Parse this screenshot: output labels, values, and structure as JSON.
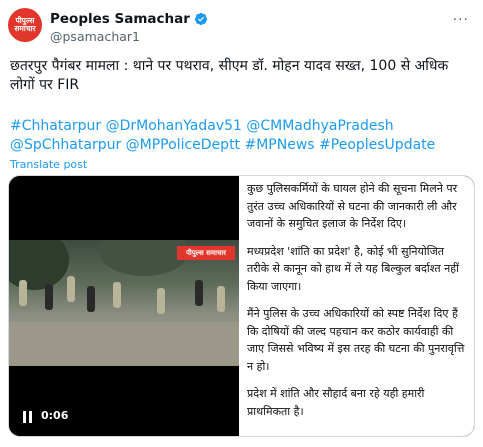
{
  "profile": {
    "avatar_text": "पीपुल्स समाचार",
    "display_name": "Peoples Samachar",
    "handle": "@psamachar1",
    "more_label": "···"
  },
  "tweet": {
    "text": "छतरपुर पैगंबर मामला : थाने पर पथराव, सीएम डॉ. मोहन यादव सख्त, 100 से अधिक लोगों पर FIR",
    "hashtags": "#Chhatarpur @DrMohanYadav51 @CMMadhyaPradesh @SpChhatarpur @MPPoliceDeptt #MPNews #PeoplesUpdate",
    "translate_label": "Translate post"
  },
  "video": {
    "channel_tag": "पीपुल्स समाचार",
    "time": "0:06"
  },
  "panel": {
    "p1": "कुछ पुलिसकर्मियों के घायल होने की सूचना मिलने पर तुरंत उच्च अधिकारियों से घटना की जानकारी ली और जवानों के समुचित इलाज के निर्देश दिए।",
    "p2": "मध्यप्रदेश 'शांति का प्रदेश' है, कोई भी सुनियोजित तरीके से कानून को हाथ में ले यह बिल्कुल बर्दाश्त नहीं किया जाएगा।",
    "p3": "मैंने पुलिस के उच्च अधिकारियों को स्पष्ट निर्देश दिए हैं कि दोषियों की जल्द पहचान कर कठोर कार्यवाही की जाए जिससे भविष्य में इस तरह की घटना की पुनरावृत्ति न हो।",
    "p4": "प्रदेश में शांति और सौहार्द बना रहे यही हमारी प्राथमिकता है।"
  },
  "colors": {
    "link": "#1d9bf0",
    "brand_red": "#e2352b",
    "verified": "#1d9bf0"
  }
}
